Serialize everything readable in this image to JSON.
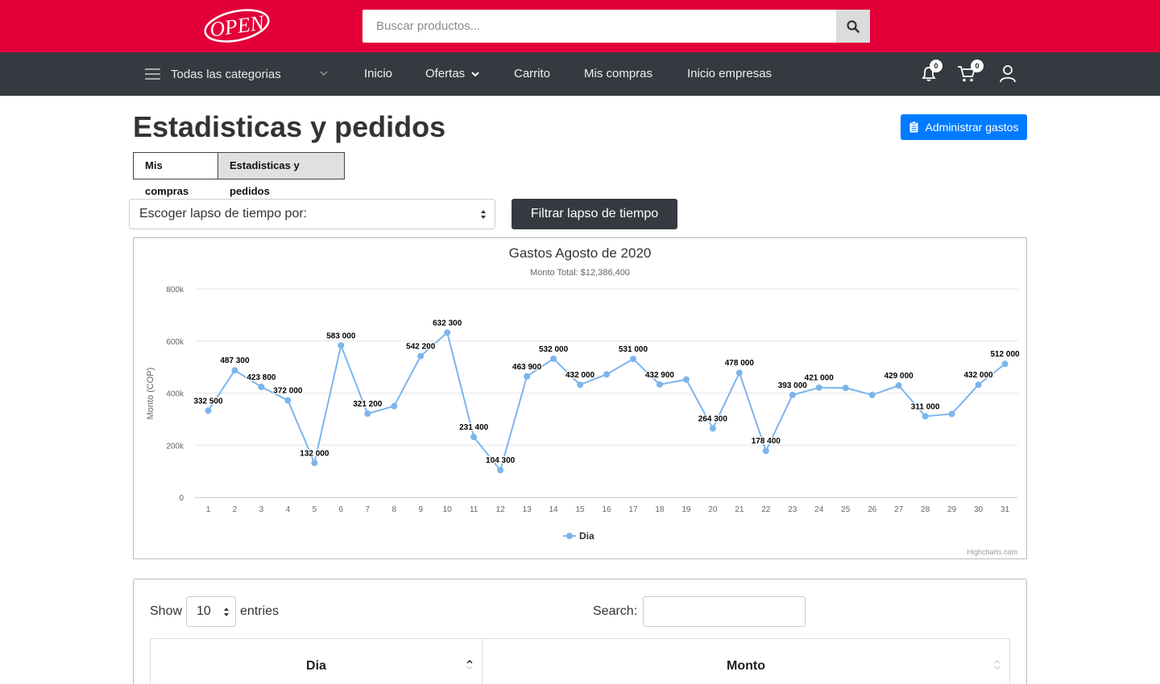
{
  "header": {
    "logo_text": "OPEN",
    "search_placeholder": "Buscar productos..."
  },
  "nav": {
    "categories_label": "Todas las categorias",
    "links": [
      "Inicio",
      "Ofertas",
      "Carrito",
      "Mis compras",
      "Inicio empresas"
    ],
    "notifications_count": "0",
    "cart_count": "0"
  },
  "page": {
    "title": "Estadisticas y pedidos",
    "admin_button": "Administrar gastos",
    "tabs": [
      "Mis compras",
      "Estadisticas y pedidos"
    ],
    "lapse_select": "Escoger lapso de tiempo por:",
    "filter_button": "Filtrar lapso de tiempo"
  },
  "chart_data": {
    "type": "line",
    "title": "Gastos Agosto de 2020",
    "subtitle": "Monto Total: $12,386,400",
    "ylabel": "Monto (COP)",
    "xlabel": "",
    "ylim": [
      0,
      800000
    ],
    "yticks": [
      0,
      200000,
      400000,
      600000,
      800000
    ],
    "ytick_labels": [
      "0",
      "200k",
      "400k",
      "600k",
      "800k"
    ],
    "grid": true,
    "legend": "bottom-center",
    "credits": "Highcharts.com",
    "color": "#7cb5ec",
    "categories": [
      "1",
      "2",
      "3",
      "4",
      "5",
      "6",
      "7",
      "8",
      "9",
      "10",
      "11",
      "12",
      "13",
      "14",
      "15",
      "16",
      "17",
      "18",
      "19",
      "20",
      "21",
      "22",
      "23",
      "24",
      "25",
      "26",
      "27",
      "28",
      "29",
      "30",
      "31"
    ],
    "series": [
      {
        "name": "Dia",
        "values": [
          332500,
          487300,
          423800,
          372000,
          132000,
          583000,
          321200,
          350000,
          542200,
          632300,
          231400,
          104300,
          463900,
          532000,
          432000,
          472000,
          531000,
          432900,
          452000,
          264300,
          478000,
          178400,
          393000,
          421000,
          420000,
          393000,
          429000,
          311000,
          320000,
          432000,
          512000
        ],
        "labels": [
          "332 500",
          "487 300",
          "423 800",
          "372 000",
          "132 000",
          "583 000",
          "321 200",
          "",
          "542 200",
          "632 300",
          "231 400",
          "104 300",
          "463 900",
          "532 000",
          "432 000",
          "",
          "531 000",
          "432 900",
          "",
          "264 300",
          "478 000",
          "178 400",
          "393 000",
          "421 000",
          "",
          "",
          "429 000",
          "311 000",
          "",
          "432 000",
          "512 000"
        ]
      }
    ]
  },
  "table": {
    "show_label": "Show",
    "entries_value": "10",
    "entries_label": "entries",
    "search_label": "Search:",
    "columns": [
      "Dia",
      "Monto"
    ]
  }
}
